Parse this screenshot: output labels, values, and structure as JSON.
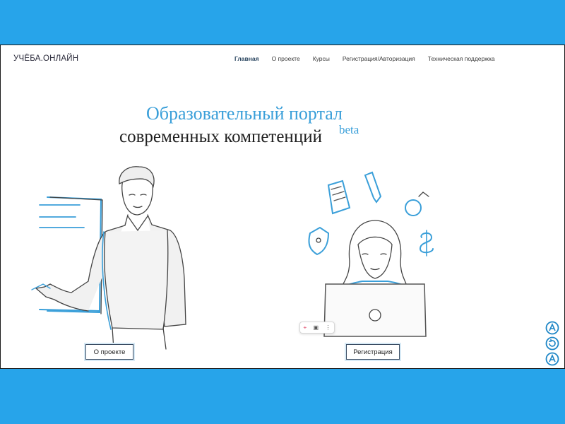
{
  "header": {
    "logo": "УЧЁБА.ОНЛАЙН",
    "nav": [
      "Главная",
      "О проекте",
      "Курсы",
      "Регистрация/Авторизация",
      "Техническая поддержка"
    ]
  },
  "hero": {
    "title_line1": "Образовательный портал",
    "title_line2": "современных компетенций",
    "beta": "beta"
  },
  "buttons": {
    "about": "О проекте",
    "register": "Регистрация"
  },
  "colors": {
    "frame_bg": "#27a4ea",
    "accent": "#3a9fd9",
    "button_border": "#3c4e64"
  }
}
